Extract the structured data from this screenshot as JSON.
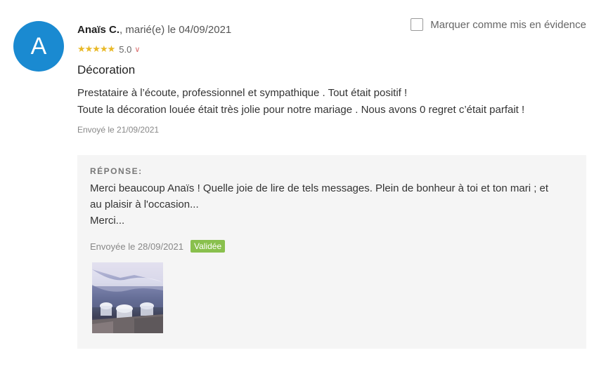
{
  "review": {
    "avatar_letter": "A",
    "author": "Anaïs C.",
    "meta": ", marié(e) le 04/09/2021",
    "stars": "★★★★★",
    "rating": "5.0",
    "feature_label": "Marquer comme mis en évidence",
    "title": "Décoration",
    "text_line1": "Prestataire à l’écoute, professionnel et sympathique . Tout était positif !",
    "text_line2": "Toute la décoration louée était très jolie pour notre mariage . Nous avons 0 regret c’était parfait !",
    "sent": "Envoyé le 21/09/2021"
  },
  "response": {
    "label": "RÉPONSE:",
    "text_line1": "Merci beaucoup Anaïs ! Quelle joie de lire de tels messages. Plein de bonheur à toi et ton mari ; et",
    "text_line2": "au plaisir à l'occasion...",
    "text_line3": "Merci...",
    "sent": "Envoyée le 28/09/2021",
    "status": "Validée"
  },
  "colors": {
    "avatar": "#1a8ad1",
    "stars": "#e9b928",
    "badge": "#89c04d",
    "response_bg": "#f5f5f5"
  }
}
